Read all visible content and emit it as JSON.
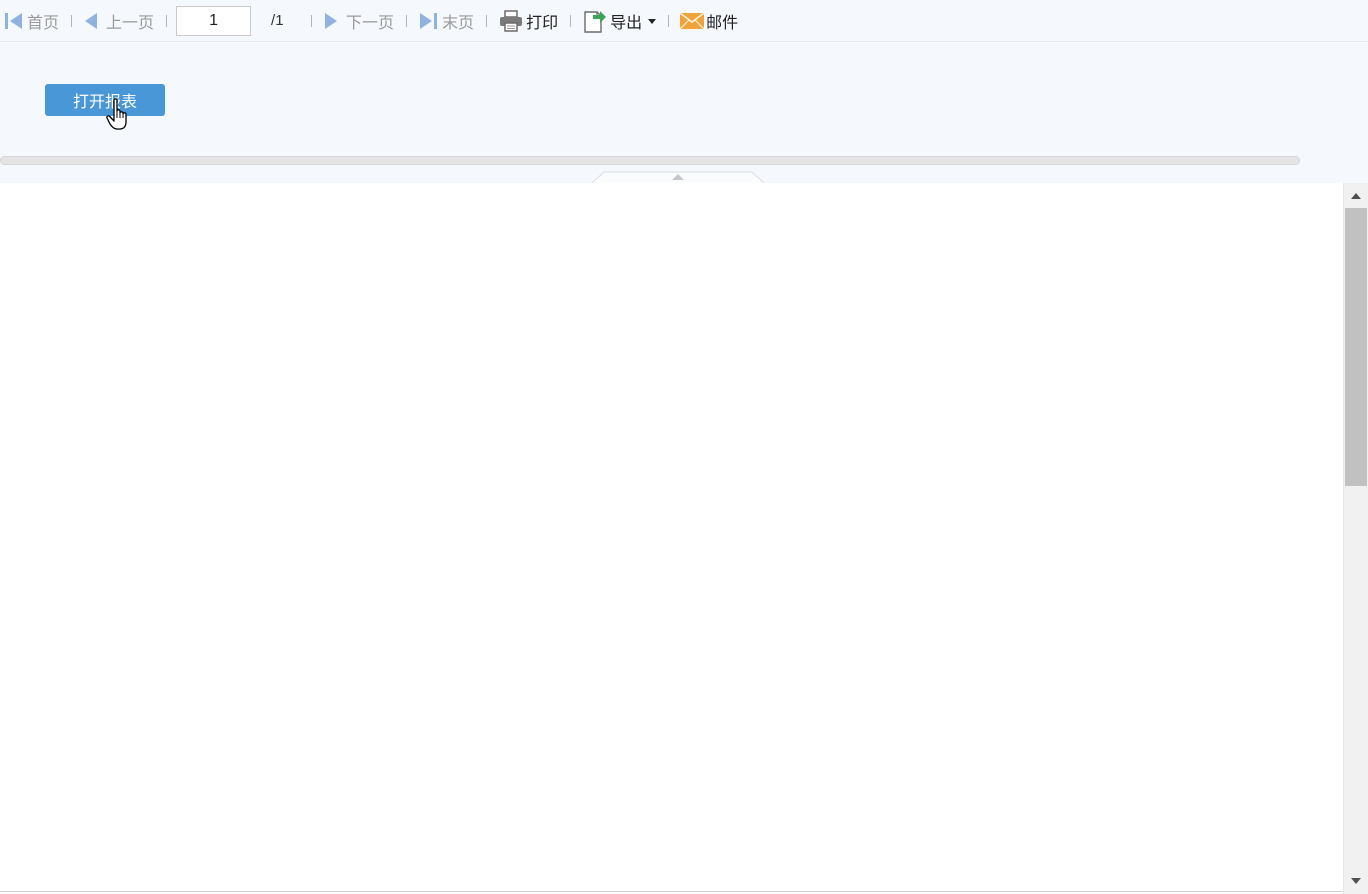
{
  "toolbar": {
    "first_label": "首页",
    "prev_label": "上一页",
    "page_current": "1",
    "page_total": "/1",
    "next_label": "下一页",
    "last_label": "末页",
    "print_label": "打印",
    "export_label": "导出",
    "mail_label": "邮件"
  },
  "params": {
    "open_report_label": "打开报表"
  },
  "colors": {
    "button_blue": "#4a97d8",
    "toolbar_bg": "#f5f8fc",
    "nav_icon_blue": "#8fb3de",
    "export_green": "#3aa655",
    "mail_orange": "#f0a33a"
  }
}
